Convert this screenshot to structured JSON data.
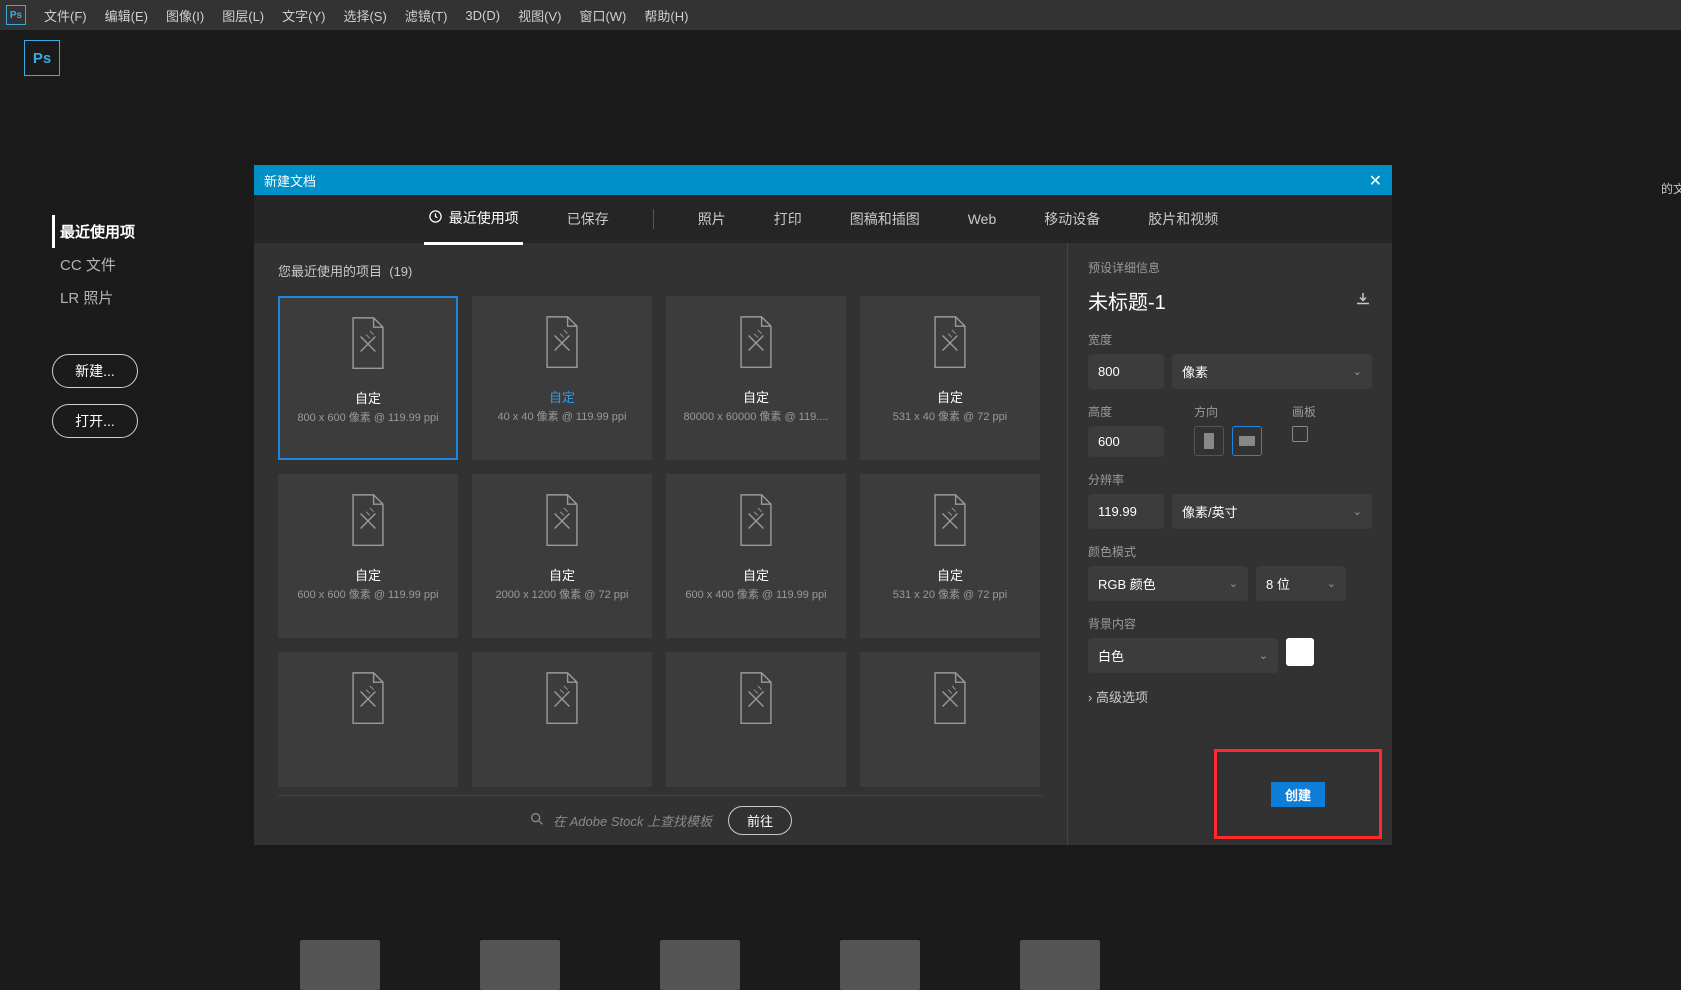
{
  "menubar": {
    "items": [
      "文件(F)",
      "编辑(E)",
      "图像(I)",
      "图层(L)",
      "文字(Y)",
      "选择(S)",
      "滤镜(T)",
      "3D(D)",
      "视图(V)",
      "窗口(W)",
      "帮助(H)"
    ]
  },
  "sidebar": {
    "items": [
      "最近使用项",
      "CC 文件",
      "LR 照片"
    ],
    "active_index": 0,
    "new_button": "新建...",
    "open_button": "打开..."
  },
  "dialog": {
    "title": "新建文档",
    "tabs": {
      "recent": "最近使用项",
      "saved": "已保存",
      "photo": "照片",
      "print": "打印",
      "art": "图稿和插图",
      "web": "Web",
      "mobile": "移动设备",
      "film": "胶片和视频"
    },
    "recent_label": "您最近使用的项目",
    "recent_count": "(19)",
    "presets": [
      {
        "name": "自定",
        "sub": "800 x 600 像素 @ 119.99 ppi",
        "sel": true
      },
      {
        "name": "自定",
        "sub": "40 x 40 像素 @ 119.99 ppi",
        "blue": true
      },
      {
        "name": "自定",
        "sub": "80000 x 60000 像素 @ 119...."
      },
      {
        "name": "自定",
        "sub": "531 x 40 像素 @ 72 ppi"
      },
      {
        "name": "自定",
        "sub": "600 x 600 像素 @ 119.99 ppi"
      },
      {
        "name": "自定",
        "sub": "2000 x 1200 像素 @ 72 ppi"
      },
      {
        "name": "自定",
        "sub": "600 x 400 像素 @ 119.99 ppi"
      },
      {
        "name": "自定",
        "sub": "531 x 20 像素 @ 72 ppi"
      },
      {
        "name": "",
        "sub": ""
      },
      {
        "name": "",
        "sub": ""
      },
      {
        "name": "",
        "sub": ""
      },
      {
        "name": "",
        "sub": ""
      }
    ],
    "search_placeholder": "在 Adobe Stock  上查找模板",
    "go_button": "前往"
  },
  "details": {
    "header": "预设详细信息",
    "doc_name": "未标题-1",
    "width_label": "宽度",
    "width_value": "800",
    "unit_value": "像素",
    "height_label": "高度",
    "height_value": "600",
    "orientation_label": "方向",
    "artboard_label": "画板",
    "resolution_label": "分辨率",
    "resolution_value": "119.99",
    "resolution_unit": "像素/英寸",
    "color_mode_label": "颜色模式",
    "color_mode_value": "RGB 颜色",
    "bit_depth_value": "8 位",
    "bg_label": "背景内容",
    "bg_value": "白色",
    "advanced": "高级选项",
    "create_button": "创建"
  },
  "other_text": "的文"
}
